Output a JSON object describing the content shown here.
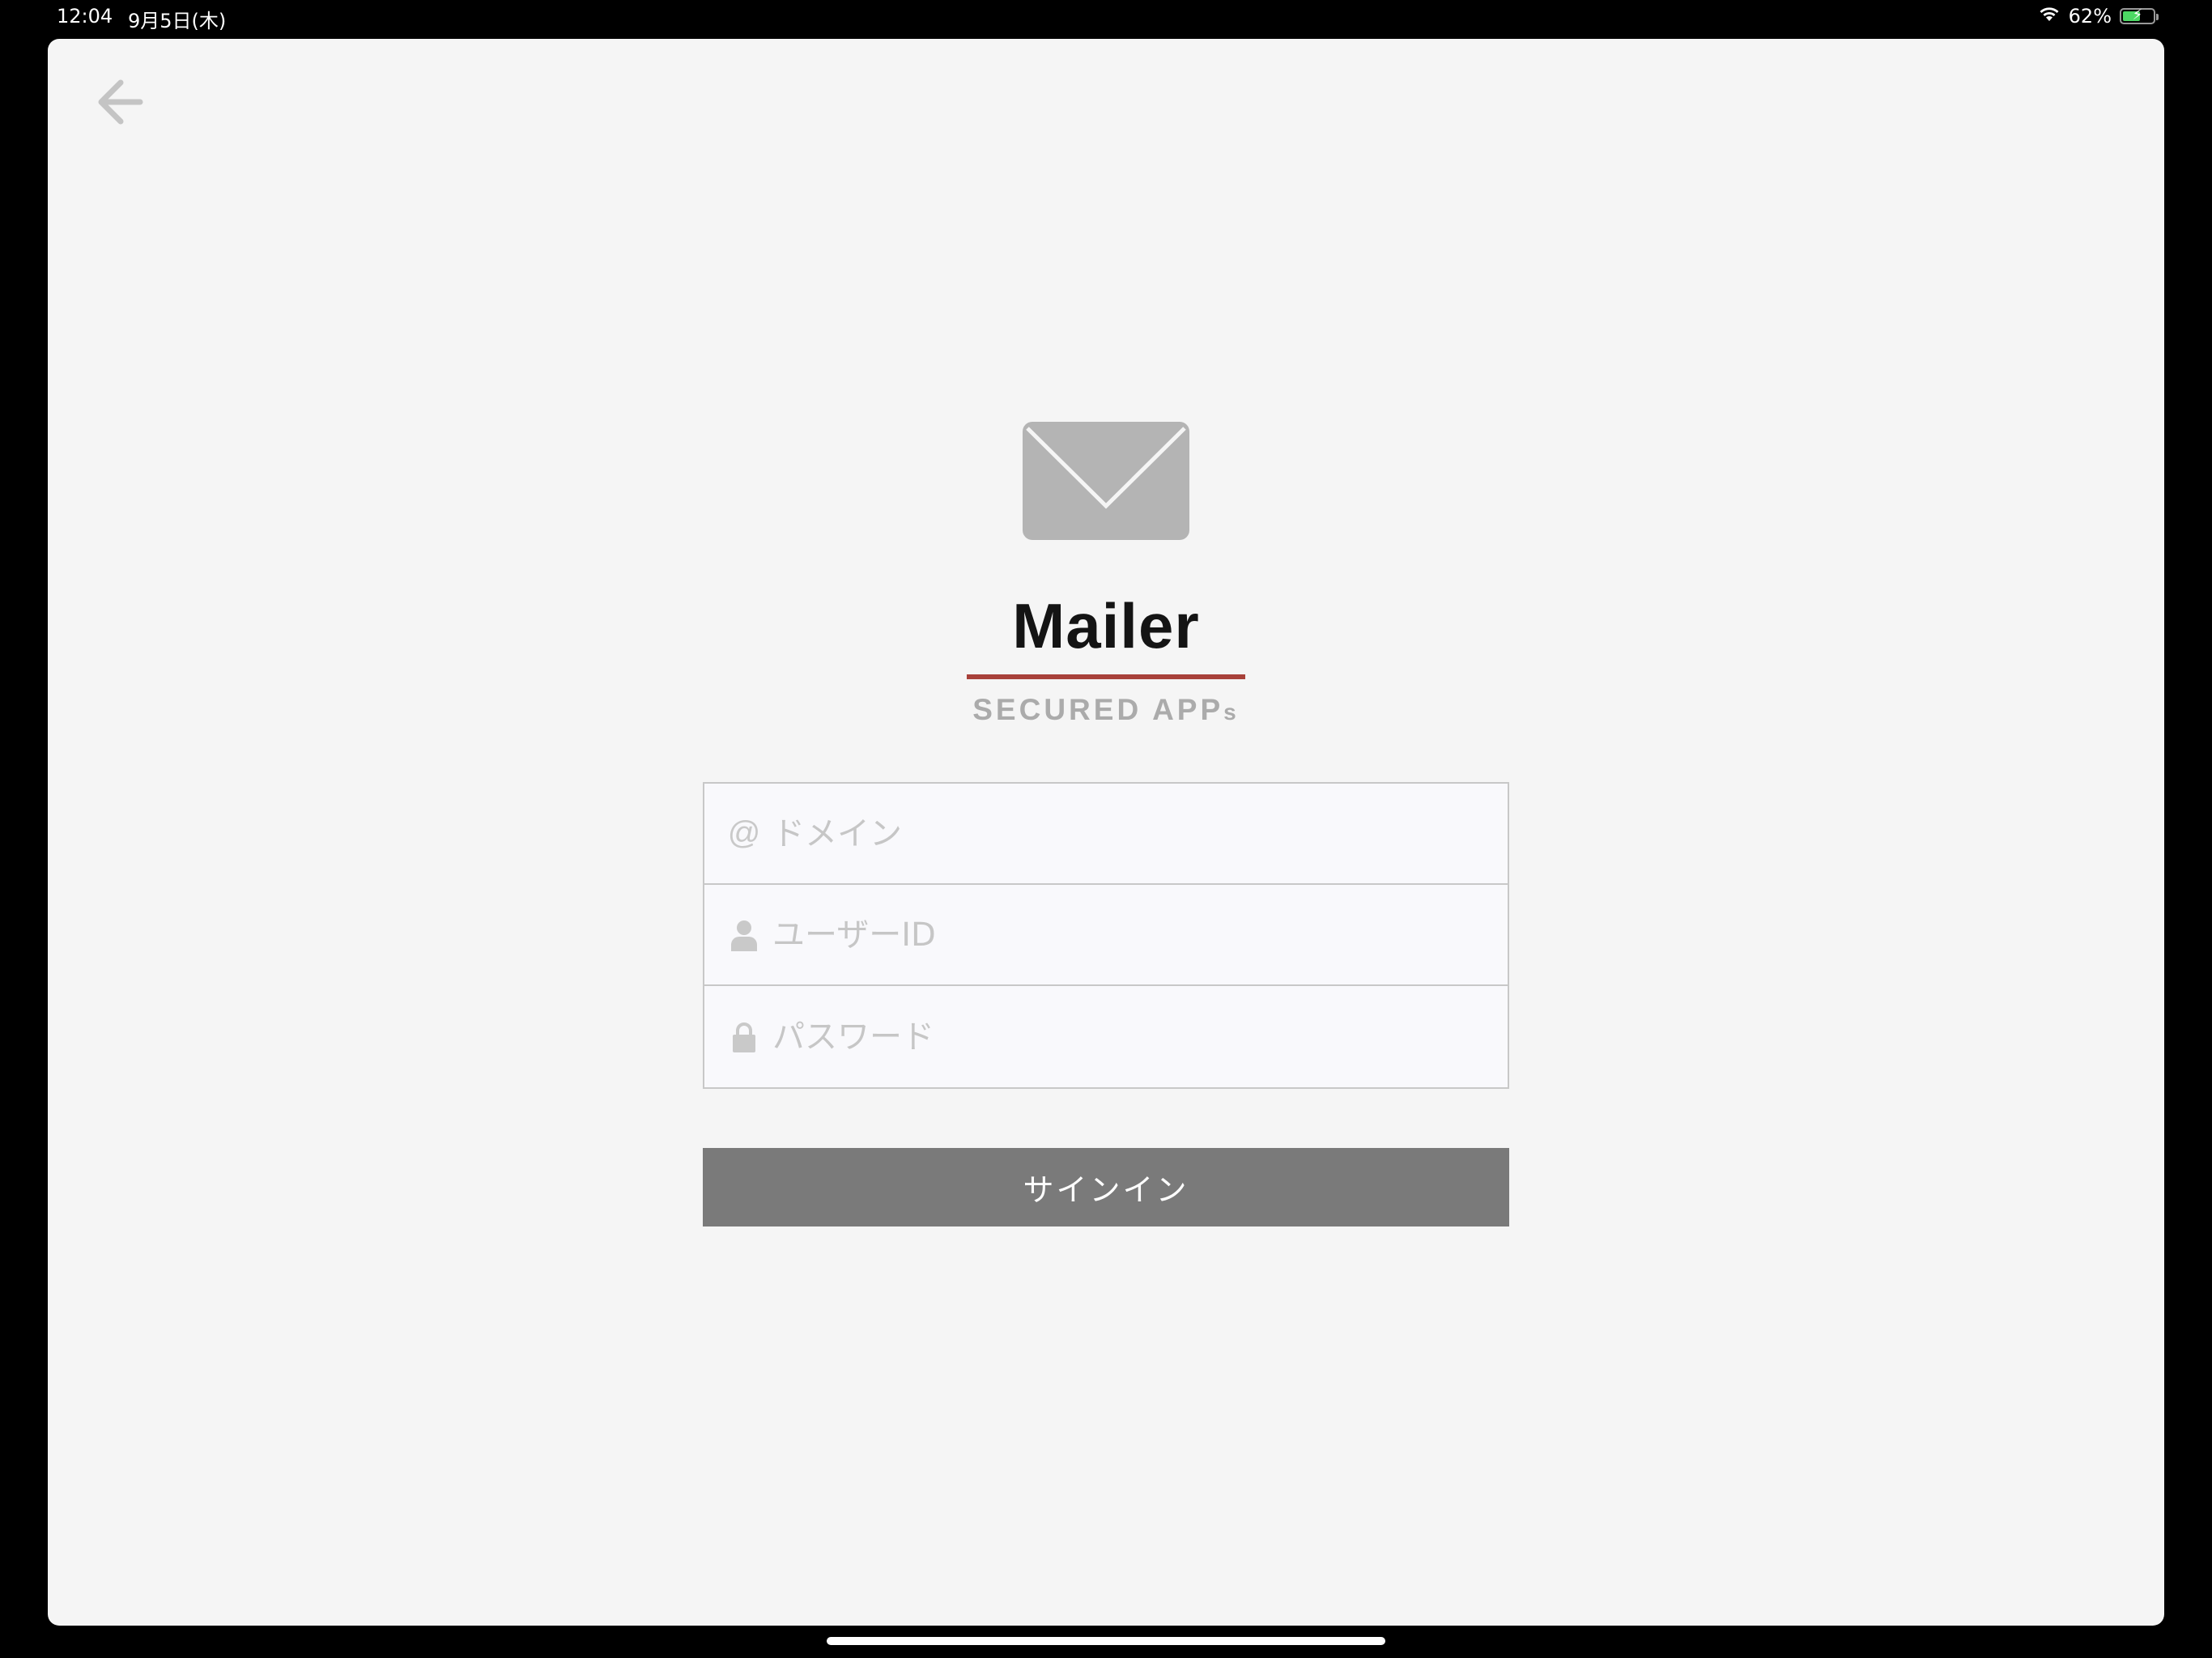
{
  "status_bar": {
    "time": "12:04",
    "date": "9月5日(木)",
    "battery_percent_label": "62%",
    "battery_level": 0.62,
    "wifi_icon": "wifi-icon",
    "battery_icon": "battery-charging-icon"
  },
  "navigation": {
    "back_icon": "arrow-left-icon"
  },
  "branding": {
    "logo_icon": "envelope-icon",
    "app_name": "Mailer",
    "tagline_main": "SECURED APP",
    "tagline_suffix": "s",
    "accent_color": "#a8413a"
  },
  "form": {
    "domain": {
      "icon_glyph": "@",
      "icon": "at-icon",
      "placeholder": "ドメイン",
      "value": ""
    },
    "user_id": {
      "icon": "person-icon",
      "placeholder": "ユーザーID",
      "value": ""
    },
    "password": {
      "icon": "lock-icon",
      "placeholder": "パスワード",
      "value": ""
    }
  },
  "actions": {
    "signin_label": "サインイン",
    "signin_color": "#7a7a7a"
  }
}
